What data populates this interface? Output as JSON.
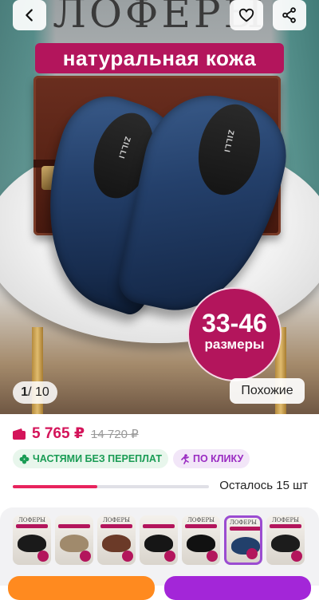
{
  "header": {
    "back_icon": "chevron-left-icon",
    "favorite_icon": "heart-icon",
    "share_icon": "share-icon"
  },
  "gallery": {
    "promo_title": "ЛОФЕРЫ",
    "promo_subtitle": "натуральная кожа",
    "size_range": "33-46",
    "size_label": "размеры",
    "insole_brand": "ZILLI",
    "counter_current": "1",
    "counter_total": "/ 10",
    "similar_label": "Похожие"
  },
  "pricing": {
    "price": "5 765 ₽",
    "old_price": "14 720 ₽",
    "installment_badge": "ЧАСТЯМИ БЕЗ ПЕРЕПЛАТ",
    "click_badge": "ПО КЛИКУ",
    "stock_text": "Осталось 15 шт",
    "stock_fraction": 0.43
  },
  "thumbnails": {
    "items": [
      {
        "label": "ЛОФЕРЫ",
        "shoe_color": "#1a1a1a",
        "active": false
      },
      {
        "label": "",
        "shoe_color": "#a08a6c",
        "active": false
      },
      {
        "label": "ЛОФЕРЫ",
        "shoe_color": "#6b3a28",
        "active": false
      },
      {
        "label": "",
        "shoe_color": "#161616",
        "active": false
      },
      {
        "label": "ЛОФЕРЫ",
        "shoe_color": "#111111",
        "active": false
      },
      {
        "label": "ЛОФЕРЫ",
        "shoe_color": "#22406b",
        "active": true
      },
      {
        "label": "ЛОФЕРЫ",
        "shoe_color": "#1c1c1c",
        "active": false
      }
    ]
  },
  "colors": {
    "brand_magenta": "#b3155c",
    "price_red": "#d4145a",
    "accent_orange": "#ff8a1f",
    "accent_purple": "#a326d8"
  }
}
